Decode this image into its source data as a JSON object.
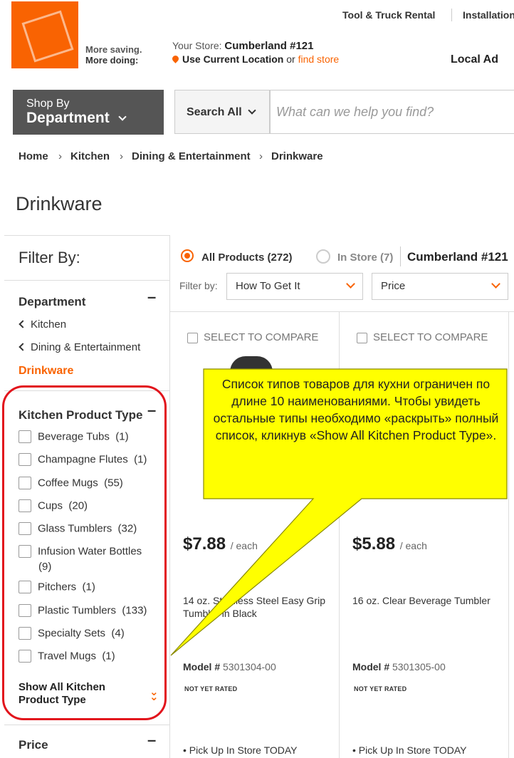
{
  "header": {
    "tagline_1": "More saving.",
    "tagline_2": "More doing:",
    "topnav": [
      "Tool & Truck Rental",
      "Installation"
    ],
    "store_label": "Your Store:",
    "store_name": "Cumberland #121",
    "use_location": "Use Current Location",
    "or": "or",
    "find_store": "find store",
    "local_ad": "Local Ad"
  },
  "department": {
    "shop_by": "Shop By",
    "label": "Department"
  },
  "search": {
    "scope": "Search All",
    "placeholder": "What can we help you find?"
  },
  "breadcrumb": [
    "Home",
    "Kitchen",
    "Dining & Entertainment",
    "Drinkware"
  ],
  "page_title": "Drinkware",
  "filters": {
    "title": "Filter By:",
    "department": {
      "title": "Department",
      "links": [
        "Kitchen",
        "Dining & Entertainment"
      ],
      "active": "Drinkware"
    },
    "product_type": {
      "title": "Kitchen Product Type",
      "items": [
        {
          "label": "Beverage Tubs",
          "count": "(1)"
        },
        {
          "label": "Champagne Flutes",
          "count": "(1)"
        },
        {
          "label": "Coffee Mugs",
          "count": "(55)"
        },
        {
          "label": "Cups",
          "count": "(20)"
        },
        {
          "label": "Glass Tumblers",
          "count": "(32)"
        },
        {
          "label": "Infusion Water Bottles",
          "count": "(9)"
        },
        {
          "label": "Pitchers",
          "count": "(1)"
        },
        {
          "label": "Plastic Tumblers",
          "count": "(133)"
        },
        {
          "label": "Specialty Sets",
          "count": "(4)"
        },
        {
          "label": "Travel Mugs",
          "count": "(1)"
        }
      ],
      "show_all_1": "Show All Kitchen",
      "show_all_2": "Product Type"
    },
    "price_title": "Price"
  },
  "results": {
    "all_products": "All Products (272)",
    "in_store": "In Store (7)",
    "store_name": "Cumberland #121",
    "filter_by": "Filter by:",
    "select_get_it": "How To Get It",
    "select_price": "Price"
  },
  "products": [
    {
      "compare": "SELECT TO COMPARE",
      "price": "$7.88",
      "unit": "/ each",
      "name": "14 oz. Stainless Steel Easy Grip Tumbler in Black",
      "model_label": "Model #",
      "model": "5301304-00",
      "rating": "NOT YET RATED",
      "pickup": "• Pick Up In Store TODAY"
    },
    {
      "compare": "SELECT TO COMPARE",
      "price": "$5.88",
      "unit": "/ each",
      "name": "16 oz. Clear Beverage Tumbler",
      "model_label": "Model #",
      "model": "5301305-00",
      "rating": "NOT YET RATED",
      "pickup": "• Pick Up In Store TODAY"
    }
  ],
  "annotation": {
    "text": "Список типов товаров для кухни ограничен по длине 10 наименованиями. Чтобы увидеть остальные типы необходимо «раскрыть» полный список, кликнув «Show All Kitchen Product Type».",
    "fill": "#ffff00",
    "border": "#8a8a00",
    "highlight": "#e2141c"
  },
  "colors": {
    "brand": "#f96302"
  }
}
